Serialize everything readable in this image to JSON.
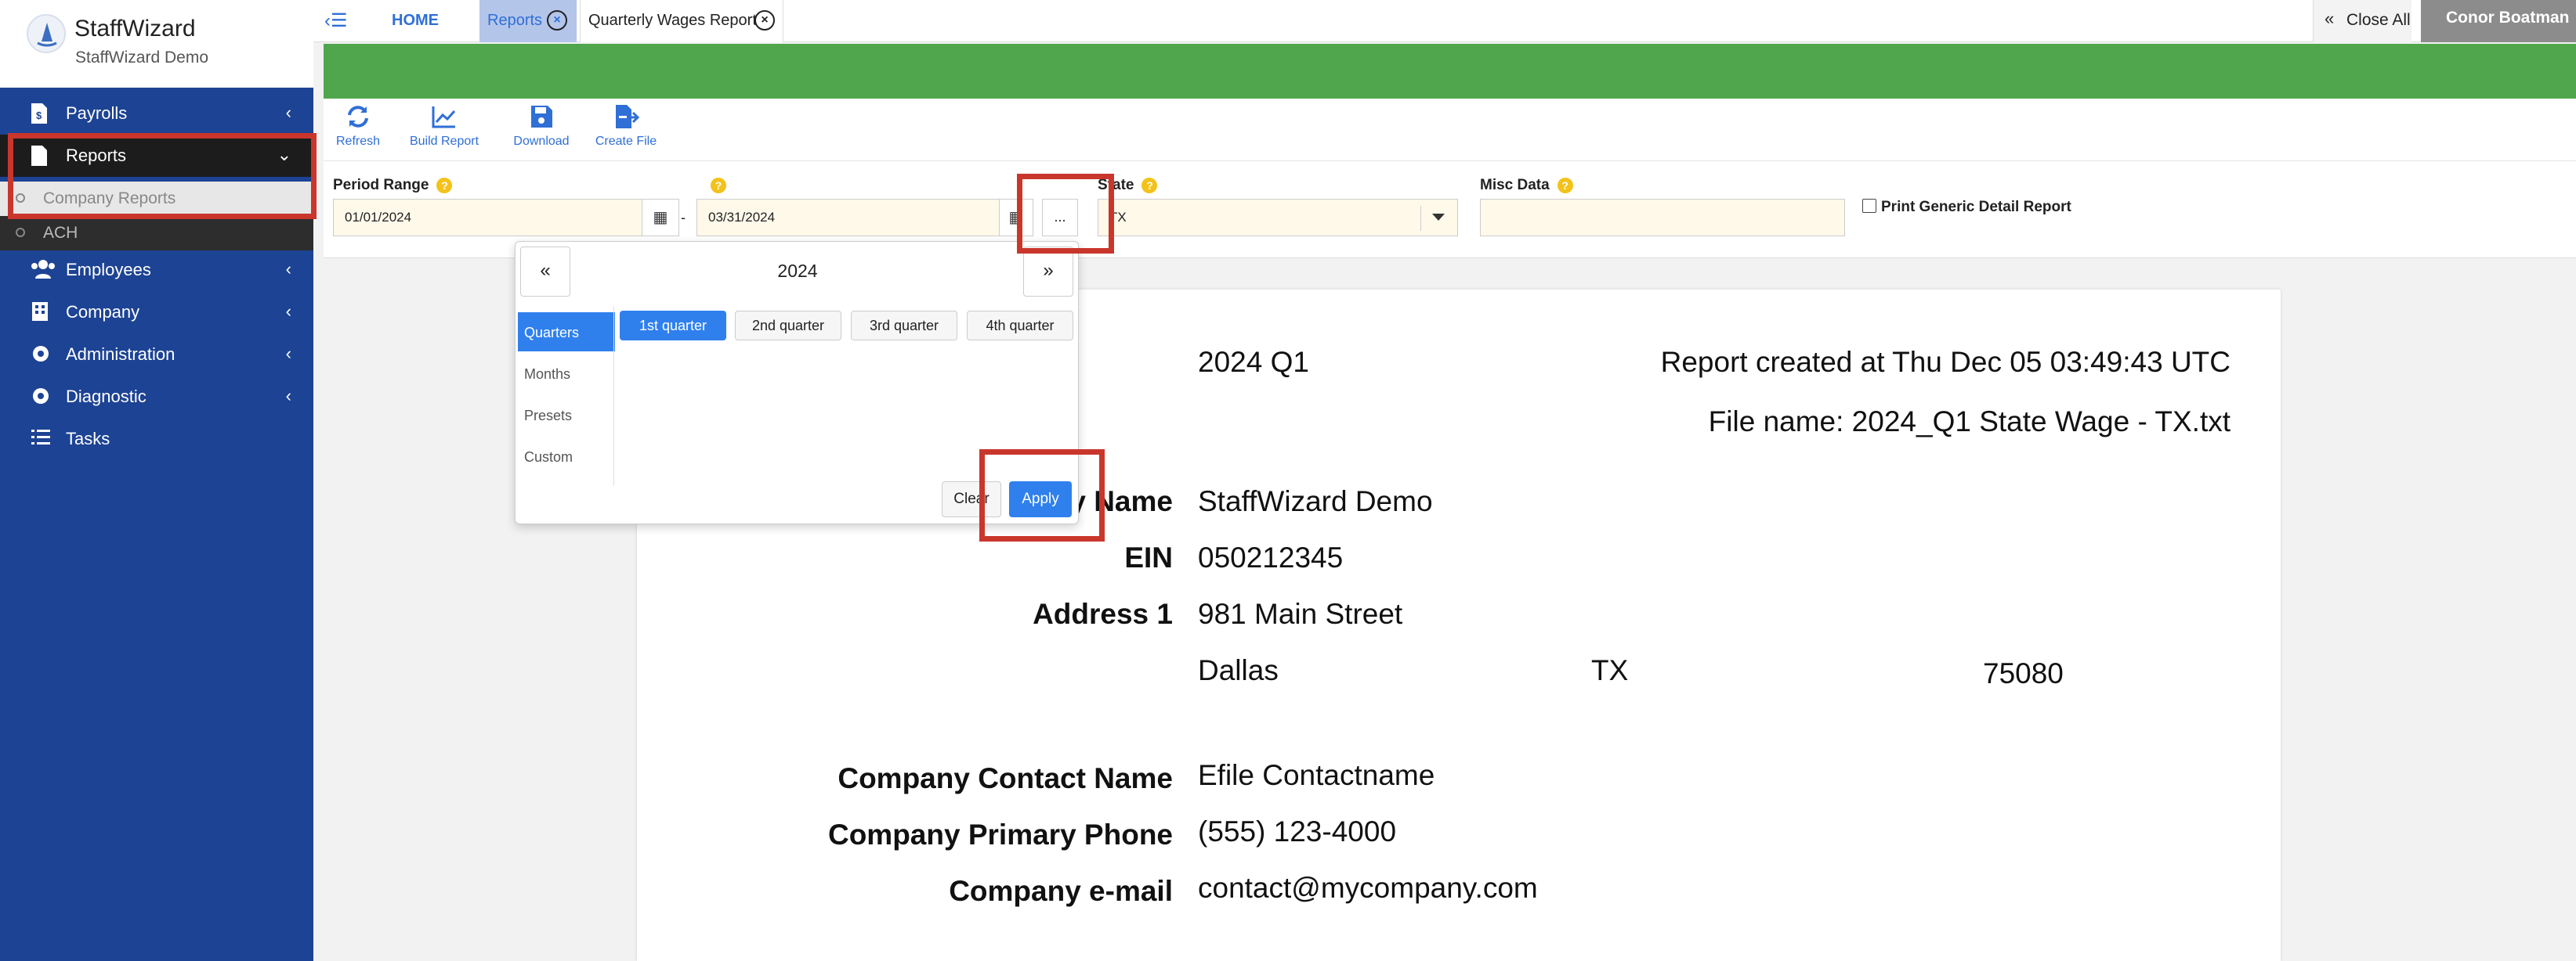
{
  "brand": {
    "name": "StaffWizard",
    "subtitle": "StaffWizard Demo"
  },
  "sidebar": {
    "items": [
      {
        "label": "Payrolls"
      },
      {
        "label": "Reports"
      },
      {
        "label": "Employees"
      },
      {
        "label": "Company"
      },
      {
        "label": "Administration"
      },
      {
        "label": "Diagnostic"
      },
      {
        "label": "Tasks"
      }
    ],
    "reports_sub": [
      {
        "label": "Company Reports"
      },
      {
        "label": "ACH"
      }
    ]
  },
  "topbar": {
    "home": "HOME",
    "tabs": [
      {
        "label": "Reports"
      },
      {
        "label": "Quarterly Wages Report"
      }
    ],
    "close_all": "Close All",
    "user": "Conor Boatman"
  },
  "toolbar": {
    "refresh": "Refresh",
    "build_report": "Build Report",
    "download": "Download",
    "create_file": "Create File"
  },
  "filters": {
    "period_label": "Period Range",
    "start_date": "01/01/2024",
    "end_date": "03/31/2024",
    "dash": "-",
    "ellipsis": "...",
    "state_label": "State",
    "state_value": "TX",
    "misc_label": "Misc Data",
    "misc_value": "",
    "print_generic": "Print Generic Detail Report"
  },
  "picker": {
    "prev": "«",
    "next": "»",
    "year": "2024",
    "tabs": [
      "Quarters",
      "Months",
      "Presets",
      "Custom"
    ],
    "quarters": [
      "1st quarter",
      "2nd quarter",
      "3rd quarter",
      "4th quarter"
    ],
    "clear": "Clear",
    "apply": "Apply"
  },
  "report": {
    "period": "2024 Q1",
    "created": "Report created at Thu Dec 05 03:49:43 UTC",
    "file_name": "File name: 2024_Q1 State Wage - TX.txt",
    "company_name_label": "Company Name",
    "company_name": "StaffWizard Demo",
    "ein_label": "EIN",
    "ein": "050212345",
    "address1_label": "Address 1",
    "address1": "981 Main Street",
    "city": "Dallas",
    "state": "TX",
    "zip": "75080",
    "contact_name_label": "Company Contact Name",
    "contact_name": "Efile Contactname",
    "phone_label": "Company Primary Phone",
    "phone": "(555) 123-4000",
    "email_label": "Company e-mail",
    "email": "contact@mycompany.com"
  },
  "colors": {
    "sidebar": "#1d4394",
    "banner": "#4fa64c",
    "accent": "#2f80ed",
    "highlight": "#c9362c"
  }
}
